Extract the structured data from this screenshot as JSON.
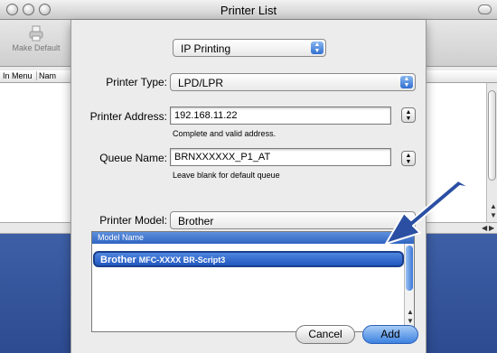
{
  "window": {
    "title": "Printer List",
    "toolbar": {
      "make_default_label": "Make Default"
    },
    "columns": [
      "In Menu",
      "Nam"
    ]
  },
  "sheet": {
    "protocol_popup": "IP Printing",
    "printer_type": {
      "label": "Printer Type:",
      "value": "LPD/LPR"
    },
    "printer_address": {
      "label": "Printer Address:",
      "value": "192.168.11.22",
      "hint": "Complete and valid address."
    },
    "queue_name": {
      "label": "Queue Name:",
      "value": "BRNXXXXXX_P1_AT",
      "hint": "Leave blank for default queue"
    },
    "printer_model": {
      "label": "Printer Model:",
      "value": "Brother"
    },
    "model_list": {
      "header": "Model Name",
      "selected": {
        "brand": "Brother",
        "model": "MFC-XXXX BR-Script3"
      }
    },
    "buttons": {
      "cancel": "Cancel",
      "add": "Add"
    }
  },
  "colors": {
    "selection": "#2257c0",
    "annotation_arrow": "#2a4fa3",
    "desktop": "#3e5fa6"
  },
  "icons": [
    "printer-icon",
    "arrow-updown-icon",
    "annotation-arrow-icon"
  ]
}
